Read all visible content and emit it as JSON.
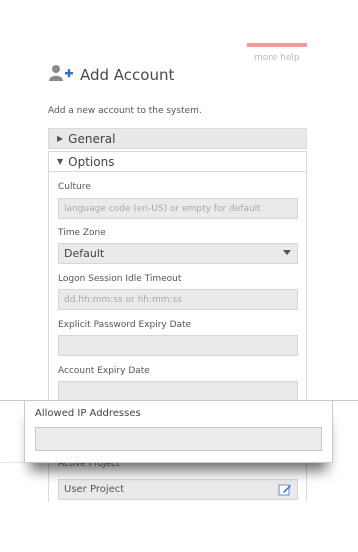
{
  "header": {
    "more_help": "more help",
    "title": "Add Account",
    "subtitle": "Add a new account to the system.",
    "title_icon": "add-user-icon"
  },
  "sections": {
    "general": "General",
    "options": "Options"
  },
  "fields": {
    "culture": {
      "label": "Culture",
      "placeholder": "language code (en-US) or empty for default"
    },
    "time_zone": {
      "label": "Time Zone",
      "value": "Default"
    },
    "logon_timeout": {
      "label": "Logon Session Idle Timeout",
      "placeholder": "dd.hh:mm:ss or hh:mm:ss"
    },
    "password_expiry": {
      "label": "Explicit Password Expiry Date",
      "value": ""
    },
    "account_expiry": {
      "label": "Account Expiry Date",
      "value": ""
    },
    "active_project": {
      "label": "Active Project",
      "value": "User Project"
    }
  },
  "popup": {
    "label": "Allowed IP Addresses",
    "value": ""
  },
  "colors": {
    "more_help_accent": "#f19a9a",
    "field_bg": "#eaeaea",
    "section_bg": "#e8e8e8"
  }
}
